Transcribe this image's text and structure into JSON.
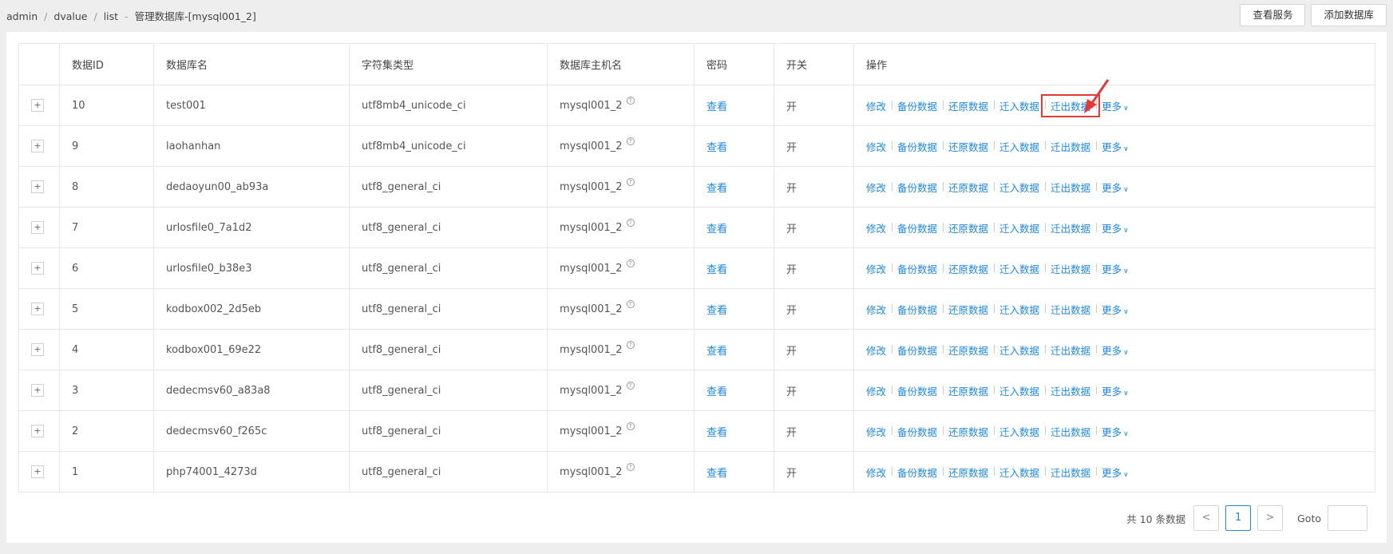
{
  "breadcrumb": [
    "admin",
    "dvalue",
    "list",
    "管理数据库-[mysql001_2]"
  ],
  "breadcrumb_sep": "/",
  "breadcrumb_dash": "-",
  "top_actions": {
    "view_service": "查看服务",
    "add_database": "添加数据库"
  },
  "table": {
    "headers": [
      "",
      "数据ID",
      "数据库名",
      "字符集类型",
      "数据库主机名",
      "密码",
      "开关",
      "操作"
    ],
    "rows": [
      {
        "id": "10",
        "name": "test001",
        "charset": "utf8mb4_unicode_ci",
        "host": "mysql001_2",
        "password": "查看",
        "switch": "开"
      },
      {
        "id": "9",
        "name": "laohanhan",
        "charset": "utf8mb4_unicode_ci",
        "host": "mysql001_2",
        "password": "查看",
        "switch": "开"
      },
      {
        "id": "8",
        "name": "dedaoyun00_ab93a",
        "charset": "utf8_general_ci",
        "host": "mysql001_2",
        "password": "查看",
        "switch": "开"
      },
      {
        "id": "7",
        "name": "urlosfile0_7a1d2",
        "charset": "utf8_general_ci",
        "host": "mysql001_2",
        "password": "查看",
        "switch": "开"
      },
      {
        "id": "6",
        "name": "urlosfile0_b38e3",
        "charset": "utf8_general_ci",
        "host": "mysql001_2",
        "password": "查看",
        "switch": "开"
      },
      {
        "id": "5",
        "name": "kodbox002_2d5eb",
        "charset": "utf8_general_ci",
        "host": "mysql001_2",
        "password": "查看",
        "switch": "开"
      },
      {
        "id": "4",
        "name": "kodbox001_69e22",
        "charset": "utf8_general_ci",
        "host": "mysql001_2",
        "password": "查看",
        "switch": "开"
      },
      {
        "id": "3",
        "name": "dedecmsv60_a83a8",
        "charset": "utf8_general_ci",
        "host": "mysql001_2",
        "password": "查看",
        "switch": "开"
      },
      {
        "id": "2",
        "name": "dedecmsv60_f265c",
        "charset": "utf8_general_ci",
        "host": "mysql001_2",
        "password": "查看",
        "switch": "开"
      },
      {
        "id": "1",
        "name": "php74001_4273d",
        "charset": "utf8_general_ci",
        "host": "mysql001_2",
        "password": "查看",
        "switch": "开"
      }
    ],
    "expand_symbol": "+",
    "help_symbol": "?",
    "row_actions": [
      "修改",
      "备份数据",
      "还原数据",
      "迁入数据",
      "迁出数据",
      "更多"
    ],
    "more_chevron": "∨"
  },
  "pagination": {
    "total_text": "共 10 条数据",
    "prev": "<",
    "current": "1",
    "next": ">",
    "goto_label": "Goto",
    "goto_value": ""
  },
  "colors": {
    "link": "#1e88e5",
    "highlight": "#e53935"
  },
  "icons": {
    "annotation_arrow": "red-arrow-icon"
  }
}
